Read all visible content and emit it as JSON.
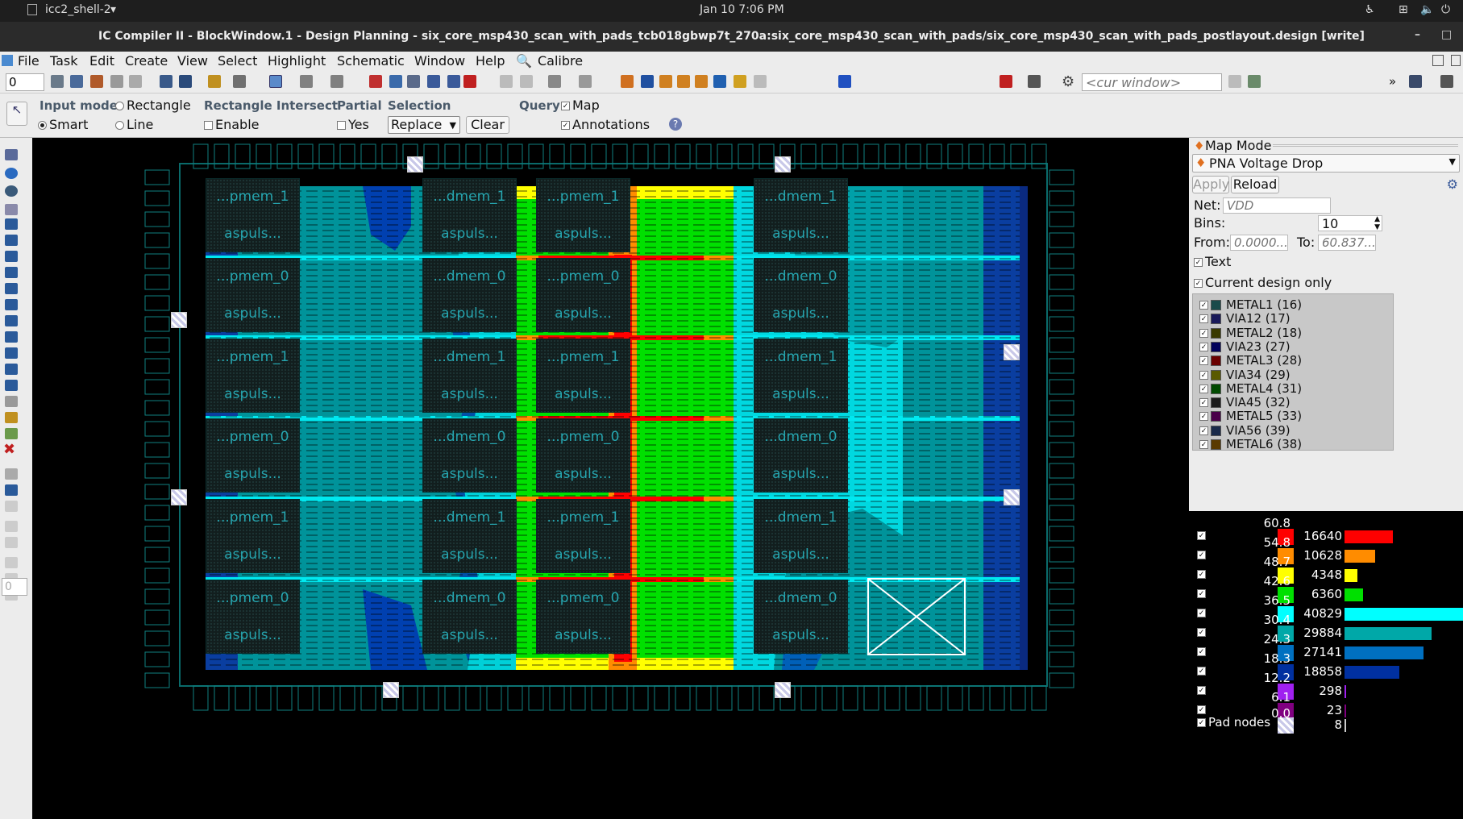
{
  "system": {
    "app_menu": "icc2_shell-2",
    "clock": "Jan 10  7:06 PM"
  },
  "window": {
    "title": "IC Compiler II - BlockWindow.1 - Design Planning - six_core_msp430_scan_with_pads_tcb018gbwp7t_270a:six_core_msp430_scan_with_pads/six_core_msp430_scan_with_pads_postlayout.design [write]"
  },
  "menu": [
    "File",
    "Task",
    "Edit",
    "Create",
    "View",
    "Select",
    "Highlight",
    "Schematic",
    "Window",
    "Help",
    "Calibre"
  ],
  "toolbar": {
    "spin_value": "0",
    "cur_window_placeholder": "<cur window>"
  },
  "options": {
    "input_mode_label": "Input mode",
    "rectangle": "Rectangle",
    "smart": "Smart",
    "line": "Line",
    "rect_intersect_label": "Rectangle Intersect",
    "enable": "Enable",
    "partial_label": "Partial",
    "yes": "Yes",
    "selection_label": "Selection",
    "selection_value": "Replace",
    "clear": "Clear",
    "query_label": "Query",
    "map": "Map",
    "annotations": "Annotations"
  },
  "left_spin": "0",
  "canvas": {
    "macros": [
      {
        "name": "...pmem_1",
        "sub": "aspuls..."
      },
      {
        "name": "...pmem_0",
        "sub": "aspuls..."
      },
      {
        "name": "...pmem_1",
        "sub": "aspuls..."
      },
      {
        "name": "...pmem_0",
        "sub": "aspuls..."
      },
      {
        "name": "...pmem_1",
        "sub": "aspuls..."
      },
      {
        "name": "...pmem_0",
        "sub": "aspuls..."
      },
      {
        "name": "...dmem_1",
        "sub": "aspuls..."
      },
      {
        "name": "...dmem_0",
        "sub": "aspuls..."
      },
      {
        "name": "...dmem_1",
        "sub": "aspuls..."
      },
      {
        "name": "...dmem_0",
        "sub": "aspuls..."
      },
      {
        "name": "...dmem_1",
        "sub": "aspuls..."
      },
      {
        "name": "...dmem_0",
        "sub": "aspuls..."
      },
      {
        "name": "...pmem_1",
        "sub": "aspuls..."
      },
      {
        "name": "...pmem_0",
        "sub": "aspuls..."
      },
      {
        "name": "...pmem_1",
        "sub": "aspuls..."
      },
      {
        "name": "...pmem_0",
        "sub": "aspuls..."
      },
      {
        "name": "...pmem_1",
        "sub": "aspuls..."
      },
      {
        "name": "...pmem_0",
        "sub": "aspuls..."
      },
      {
        "name": "...dmem_1",
        "sub": "aspuls..."
      },
      {
        "name": "...dmem_0",
        "sub": "aspuls..."
      },
      {
        "name": "...dmem_1",
        "sub": "aspuls..."
      },
      {
        "name": "...dmem_0",
        "sub": "aspuls..."
      },
      {
        "name": "...dmem_1",
        "sub": "aspuls..."
      },
      {
        "name": "...dmem_0",
        "sub": "aspuls..."
      }
    ]
  },
  "map_panel": {
    "header": "Map Mode",
    "mode": "PNA Voltage Drop",
    "apply": "Apply",
    "reload": "Reload",
    "net_label": "Net:",
    "net_placeholder": "VDD",
    "bins_label": "Bins:",
    "bins_value": "10",
    "from_label": "From:",
    "from_placeholder": "0.0000...",
    "to_label": "To:",
    "to_placeholder": "60.837...",
    "text_label": "Text",
    "current_design_label": "Current design only",
    "layers": [
      {
        "label": "METAL1 (16)",
        "color": "#1a4a4a"
      },
      {
        "label": "VIA12 (17)",
        "color": "#1a1a5a"
      },
      {
        "label": "METAL2 (18)",
        "color": "#3a3a00"
      },
      {
        "label": "VIA23 (27)",
        "color": "#00005a"
      },
      {
        "label": "METAL3 (28)",
        "color": "#6a0000"
      },
      {
        "label": "VIA34 (29)",
        "color": "#5a5a00"
      },
      {
        "label": "METAL4 (31)",
        "color": "#004a00"
      },
      {
        "label": "VIA45 (32)",
        "color": "#1a1a1a"
      },
      {
        "label": "METAL5 (33)",
        "color": "#4a004a"
      },
      {
        "label": "VIA56 (39)",
        "color": "#1a2a4a"
      },
      {
        "label": "METAL6 (38)",
        "color": "#5a3a00"
      }
    ]
  },
  "legend": {
    "bins": [
      {
        "value": "60.8",
        "count": "16640",
        "color": "#ff0000",
        "frac": 0.408
      },
      {
        "value": "54.8",
        "count": "10628",
        "color": "#ff8c00",
        "frac": 0.26
      },
      {
        "value": "48.7",
        "count": "4348",
        "color": "#ffff00",
        "frac": 0.106
      },
      {
        "value": "42.6",
        "count": "6360",
        "color": "#00e000",
        "frac": 0.156
      },
      {
        "value": "36.5",
        "count": "40829",
        "color": "#00ffff",
        "frac": 1.0
      },
      {
        "value": "30.4",
        "count": "29884",
        "color": "#00a8a8",
        "frac": 0.732
      },
      {
        "value": "24.3",
        "count": "27141",
        "color": "#0070c0",
        "frac": 0.665
      },
      {
        "value": "18.3",
        "count": "18858",
        "color": "#0030a0",
        "frac": 0.462
      },
      {
        "value": "12.2",
        "count": "298",
        "color": "#a020f0",
        "frac": 0.007
      },
      {
        "value": "6.1",
        "count": "23",
        "color": "#800080",
        "frac": 0.001
      }
    ],
    "zero": "0.0",
    "pad_label": "Pad nodes",
    "pad_count": "8"
  }
}
